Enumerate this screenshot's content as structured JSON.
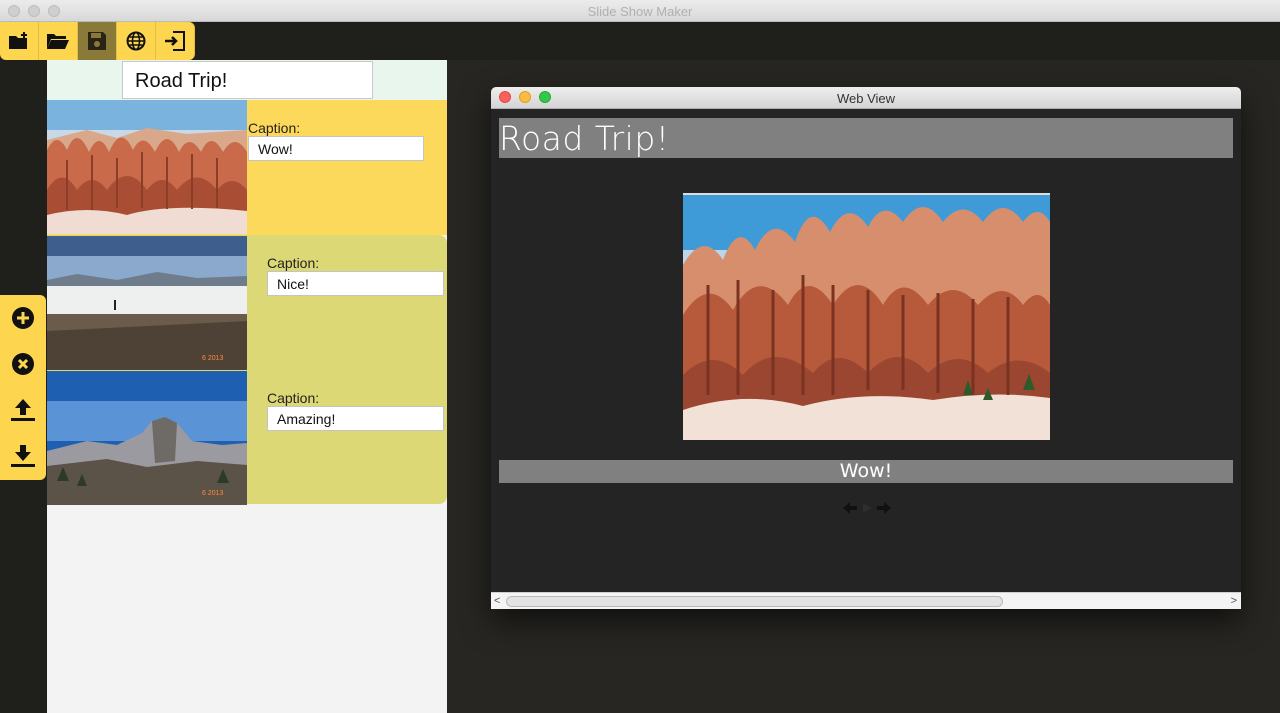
{
  "window": {
    "title": "Slide Show Maker"
  },
  "toolbar": {
    "buttons": [
      {
        "name": "new-slideshow",
        "icon": "new-folder-icon",
        "enabled": true
      },
      {
        "name": "open-slideshow",
        "icon": "open-folder-icon",
        "enabled": true
      },
      {
        "name": "save-slideshow",
        "icon": "save-disk-icon",
        "enabled": false
      },
      {
        "name": "view-web",
        "icon": "globe-icon",
        "enabled": true
      },
      {
        "name": "exit",
        "icon": "exit-icon",
        "enabled": true
      }
    ]
  },
  "editor": {
    "title_value": "Road Trip!",
    "slides": [
      {
        "caption_label": "Caption:",
        "caption_value": "Wow!",
        "image": "bryce-canyon"
      },
      {
        "caption_label": "Caption:",
        "caption_value": "Nice!",
        "image": "salt-flats"
      },
      {
        "caption_label": "Caption:",
        "caption_value": "Amazing!",
        "image": "half-dome"
      }
    ]
  },
  "side_tools": [
    {
      "name": "add-slide",
      "icon": "plus-circle-icon"
    },
    {
      "name": "remove-slide",
      "icon": "x-circle-icon"
    },
    {
      "name": "move-up",
      "icon": "upload-icon"
    },
    {
      "name": "move-down",
      "icon": "download-icon"
    }
  ],
  "webview": {
    "window_title": "Web View",
    "show_title": "Road Trip!",
    "current_caption": "Wow!",
    "nav": {
      "prev_icon": "left-arrow-icon",
      "play_icon": "play-icon",
      "next_icon": "right-arrow-icon"
    }
  },
  "colors": {
    "toolbar_yellow": "#fdd54f",
    "selected_slide": "#fdd95b",
    "slide_bg": "#ddd876",
    "pane_dark": "#272622"
  }
}
